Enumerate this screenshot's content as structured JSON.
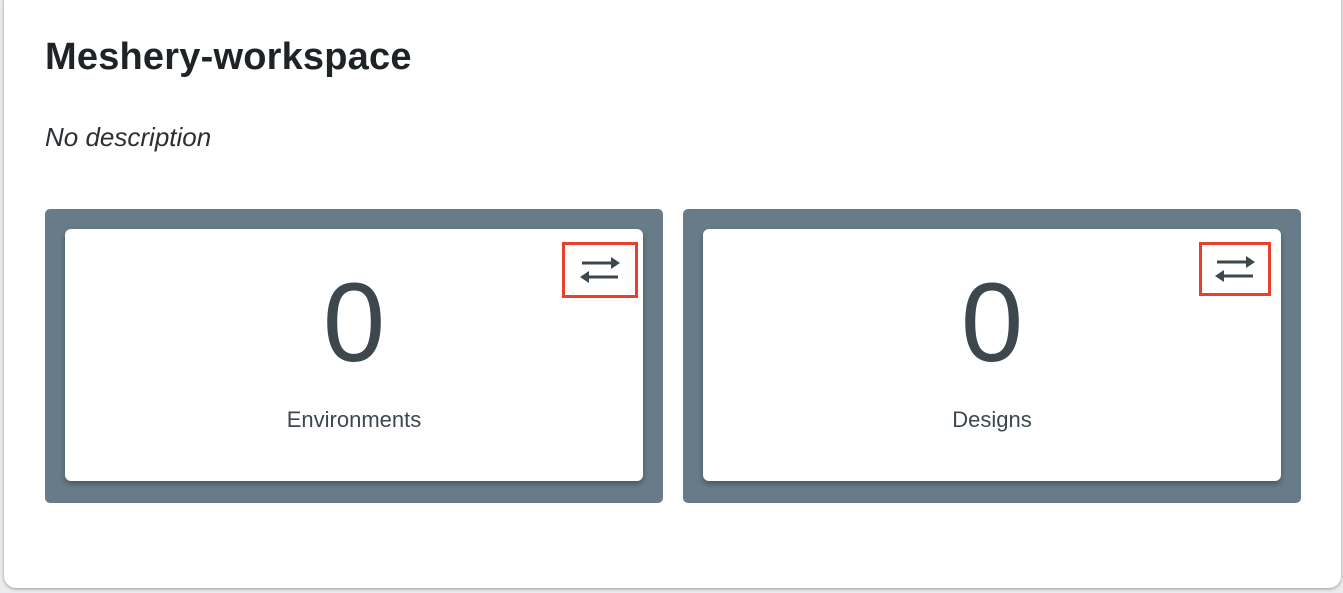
{
  "workspace": {
    "title": "Meshery-workspace",
    "description": "No description"
  },
  "stats": [
    {
      "value": "0",
      "label": "Environments",
      "action_icon": "swap-arrows-icon"
    },
    {
      "value": "0",
      "label": "Designs",
      "action_icon": "swap-arrows-icon"
    }
  ],
  "colors": {
    "panel_background": "#677c88",
    "card_background": "#ffffff",
    "text_primary": "#3c474e",
    "highlight_border": "#e8402c"
  }
}
